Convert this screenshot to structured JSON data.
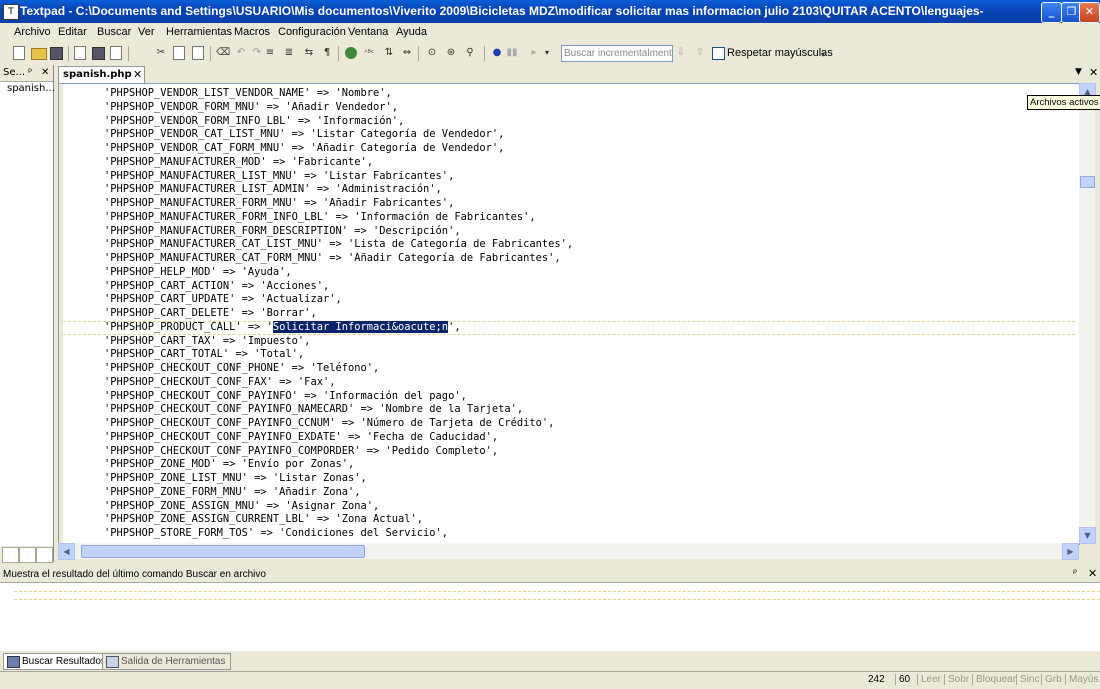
{
  "window": {
    "title": "Textpad - C:\\Documents and Settings\\USUARIO\\Mis documentos\\Viverito 2009\\Bicicletas MDZ\\modificar solicitar mas informacion julio 2103\\QUITAR ACENTO\\lenguajes-",
    "minimize": "_",
    "maximize": "❐",
    "close": "✕"
  },
  "menu": [
    "Archivo",
    "Editar",
    "Buscar",
    "Ver",
    "Herramientas",
    "Macros",
    "Configuración",
    "Ventana",
    "Ayuda"
  ],
  "toolbar": {
    "search_placeholder": "Buscar incrementalmente",
    "match_case_label": "Respetar mayúsculas",
    "overflow": "▾"
  },
  "left_panel": {
    "title": "Se...",
    "pin": "ᵖ",
    "close": "✕",
    "items": [
      "spanish...."
    ]
  },
  "tabs": [
    {
      "label": "spanish.php",
      "close": "✕"
    }
  ],
  "tab_arrow": "▼",
  "tab_close": "✕",
  "tooltip": "Archivos activos",
  "editor": {
    "current_line": 18,
    "selected_text": "Solicitar Informaci&oacute;n",
    "lines": [
      "'PHPSHOP_VENDOR_LIST_VENDOR_NAME' => 'Nombre',",
      "'PHPSHOP_VENDOR_FORM_MNU' => 'Añadir Vendedor',",
      "'PHPSHOP_VENDOR_FORM_INFO_LBL' => 'Información',",
      "'PHPSHOP_VENDOR_CAT_LIST_MNU' => 'Listar Categoría de Vendedor',",
      "'PHPSHOP_VENDOR_CAT_FORM_MNU' => 'Añadir Categoría de Vendedor',",
      "'PHPSHOP_MANUFACTURER_MOD' => 'Fabricante',",
      "'PHPSHOP_MANUFACTURER_LIST_MNU' => 'Listar Fabricantes',",
      "'PHPSHOP_MANUFACTURER_LIST_ADMIN' => 'Administración',",
      "'PHPSHOP_MANUFACTURER_FORM_MNU' => 'Añadir Fabricantes',",
      "'PHPSHOP_MANUFACTURER_FORM_INFO_LBL' => 'Información de Fabricantes',",
      "'PHPSHOP_MANUFACTURER_FORM_DESCRIPTION' => 'Descripción',",
      "'PHPSHOP_MANUFACTURER_CAT_LIST_MNU' => 'Lista de Categoría de Fabricantes',",
      "'PHPSHOP_MANUFACTURER_CAT_FORM_MNU' => 'Añadir Categoría de Fabricantes',",
      "'PHPSHOP_HELP_MOD' => 'Ayuda',",
      "'PHPSHOP_CART_ACTION' => 'Acciones',",
      "'PHPSHOP_CART_UPDATE' => 'Actualizar',",
      "'PHPSHOP_CART_DELETE' => 'Borrar',",
      "'PHPSHOP_PRODUCT_CALL' => 'Solicitar Informaci&oacute;n',",
      "'PHPSHOP_CART_TAX' => 'Impuesto',",
      "'PHPSHOP_CART_TOTAL' => 'Total',",
      "'PHPSHOP_CHECKOUT_CONF_PHONE' => 'Teléfono',",
      "'PHPSHOP_CHECKOUT_CONF_FAX' => 'Fax',",
      "'PHPSHOP_CHECKOUT_CONF_PAYINFO' => 'Información del pago',",
      "'PHPSHOP_CHECKOUT_CONF_PAYINFO_NAMECARD' => 'Nombre de la Tarjeta',",
      "'PHPSHOP_CHECKOUT_CONF_PAYINFO_CCNUM' => 'Número de Tarjeta de Crédito',",
      "'PHPSHOP_CHECKOUT_CONF_PAYINFO_EXDATE' => 'Fecha de Caducidad',",
      "'PHPSHOP_CHECKOUT_CONF_PAYINFO_COMPORDER' => 'Pedido Completo',",
      "'PHPSHOP_ZONE_MOD' => 'Envío por Zonas',",
      "'PHPSHOP_ZONE_LIST_MNU' => 'Listar Zonas',",
      "'PHPSHOP_ZONE_FORM_MNU' => 'Añadir Zona',",
      "'PHPSHOP_ZONE_ASSIGN_MNU' => 'Asignar Zona',",
      "'PHPSHOP_ZONE_ASSIGN_CURRENT_LBL' => 'Zona Actual',",
      "'PHPSHOP_STORE_FORM_TOS' => 'Condiciones del Servicio',"
    ]
  },
  "output": {
    "title": "Muestra el resultado del último comando Buscar en archivo",
    "pin": "ᵖ",
    "close": "✕",
    "tabs": [
      {
        "label": "Buscar Resultados",
        "active": true
      },
      {
        "label": "Salida de Herramientas",
        "active": false
      }
    ]
  },
  "status": {
    "line": "242",
    "column": "60",
    "indicators": [
      "Leer",
      "Sobr",
      "Bloquear",
      "Sinc",
      "Grb",
      "Mayús"
    ]
  }
}
